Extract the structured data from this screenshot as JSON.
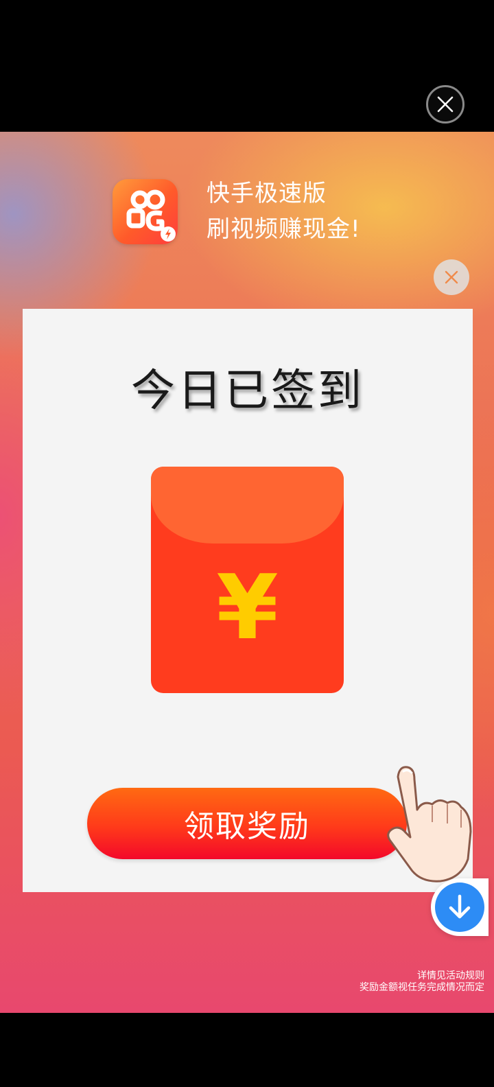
{
  "top_bar": {
    "close_icon": "close-icon"
  },
  "app_header": {
    "logo_icon": "kuaishou-app-logo",
    "name": "快手极速版",
    "tagline": "刷视频赚现金!"
  },
  "popup": {
    "close_icon": "close-icon",
    "title": "今日已签到",
    "envelope_symbol": "¥",
    "claim_button_label": "领取奖励",
    "pointer_icon": "hand-pointer-icon"
  },
  "download": {
    "icon": "download-arrow-icon"
  },
  "disclaimer": {
    "line1": "详情见活动规则",
    "line2": "奖励金额视任务完成情况而定"
  },
  "colors": {
    "accent_red": "#ff3c1e",
    "accent_orange": "#ff6532",
    "gold": "#ffcc00",
    "download_blue": "#2d8cf5"
  }
}
